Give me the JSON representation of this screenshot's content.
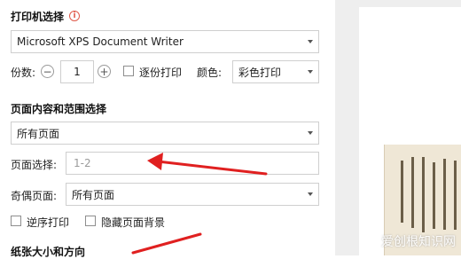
{
  "printer": {
    "section_title": "打印机选择",
    "info_icon": "info-icon",
    "selected": "Microsoft XPS Document Writer"
  },
  "copies": {
    "label": "份数:",
    "value": "1",
    "minus": "−",
    "plus": "+",
    "collate_label": "逐份打印",
    "collate_checked": false
  },
  "color": {
    "label": "颜色:",
    "selected": "彩色打印"
  },
  "page_range": {
    "section_title": "页面内容和范围选择",
    "selected": "所有页面",
    "pages_label": "页面选择:",
    "pages_placeholder": "1-2",
    "odd_even_label": "奇偶页面:",
    "odd_even_selected": "所有页面",
    "reverse_label": "逆序打印",
    "reverse_checked": false,
    "hide_bg_label": "隐藏页面背景",
    "hide_bg_checked": false
  },
  "paper": {
    "section_title": "纸张大小和方向"
  },
  "watermark": "爱创根知识网",
  "colors": {
    "arrow": "#e02020",
    "info": "#e05a4a",
    "border": "#cfcfcf"
  }
}
